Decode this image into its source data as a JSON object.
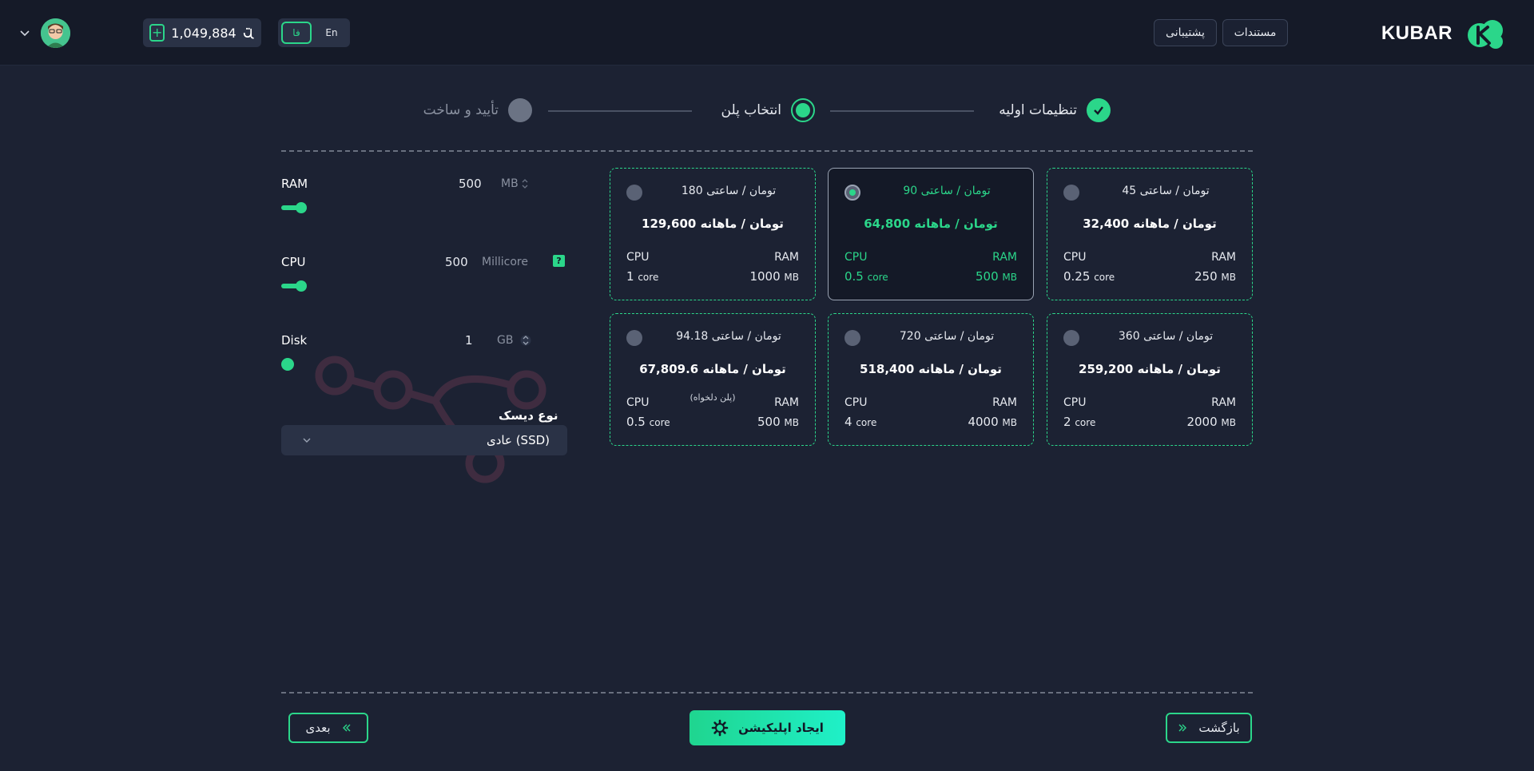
{
  "header": {
    "brand": "KUBAR",
    "docs_label": "مستندات",
    "support_label": "پشتیبانی",
    "languages": [
      "En",
      "فا"
    ],
    "active_language": "فا",
    "balance": "1,049,884",
    "currency_icon": "toman-icon",
    "add_credit_icon": "plus-icon"
  },
  "stepper": {
    "steps": [
      {
        "label": "تنظیمات اولیه",
        "state": "done"
      },
      {
        "label": "انتخاب پلن",
        "state": "active"
      },
      {
        "label": "تأیید و ساخت",
        "state": "pending"
      }
    ]
  },
  "resources": {
    "ram": {
      "title": "RAM",
      "value": "500",
      "unit": "MB"
    },
    "cpu": {
      "title": "CPU",
      "value": "500",
      "unit": "Millicore",
      "help": "?"
    },
    "disk": {
      "title": "Disk",
      "value": "1",
      "unit": "GB"
    },
    "disk_type_label": "نوع دیسک",
    "disk_type_value": "عادی (SSD)"
  },
  "plans": [
    {
      "hourly": "45 تومان / ساعتی",
      "monthly": "32,400 تومان / ماهانه",
      "ram_label": "RAM",
      "ram_value": "250",
      "ram_unit": "MB",
      "cpu_label": "CPU",
      "cpu_value": "0.25",
      "cpu_unit": "core",
      "selected": false
    },
    {
      "hourly": "90 تومان / ساعتی",
      "monthly": "64,800 تومان / ماهانه",
      "ram_label": "RAM",
      "ram_value": "500",
      "ram_unit": "MB",
      "cpu_label": "CPU",
      "cpu_value": "0.5",
      "cpu_unit": "core",
      "selected": true
    },
    {
      "hourly": "180 تومان / ساعتی",
      "monthly": "129,600 تومان / ماهانه",
      "ram_label": "RAM",
      "ram_value": "1000",
      "ram_unit": "MB",
      "cpu_label": "CPU",
      "cpu_value": "1",
      "cpu_unit": "core",
      "selected": false
    },
    {
      "hourly": "360 تومان / ساعتی",
      "monthly": "259,200 تومان / ماهانه",
      "ram_label": "RAM",
      "ram_value": "2000",
      "ram_unit": "MB",
      "cpu_label": "CPU",
      "cpu_value": "2",
      "cpu_unit": "core",
      "selected": false
    },
    {
      "hourly": "720 تومان / ساعتی",
      "monthly": "518,400 تومان / ماهانه",
      "ram_label": "RAM",
      "ram_value": "4000",
      "ram_unit": "MB",
      "cpu_label": "CPU",
      "cpu_value": "4",
      "cpu_unit": "core",
      "selected": false
    },
    {
      "hourly": "94.18 تومان / ساعتی",
      "monthly": "67,809.6 تومان / ماهانه",
      "note": "(پلن دلخواه)",
      "ram_label": "RAM",
      "ram_value": "500",
      "ram_unit": "MB",
      "cpu_label": "CPU",
      "cpu_value": "0.5",
      "cpu_unit": "core",
      "selected": false
    }
  ],
  "footer": {
    "back_label": "بازگشت",
    "create_label": "ایجاد اپلیکیشن",
    "next_label": "بعدی"
  },
  "colors": {
    "accent": "#2bd68a",
    "background": "#1c2233",
    "header_bg": "#151a28"
  }
}
